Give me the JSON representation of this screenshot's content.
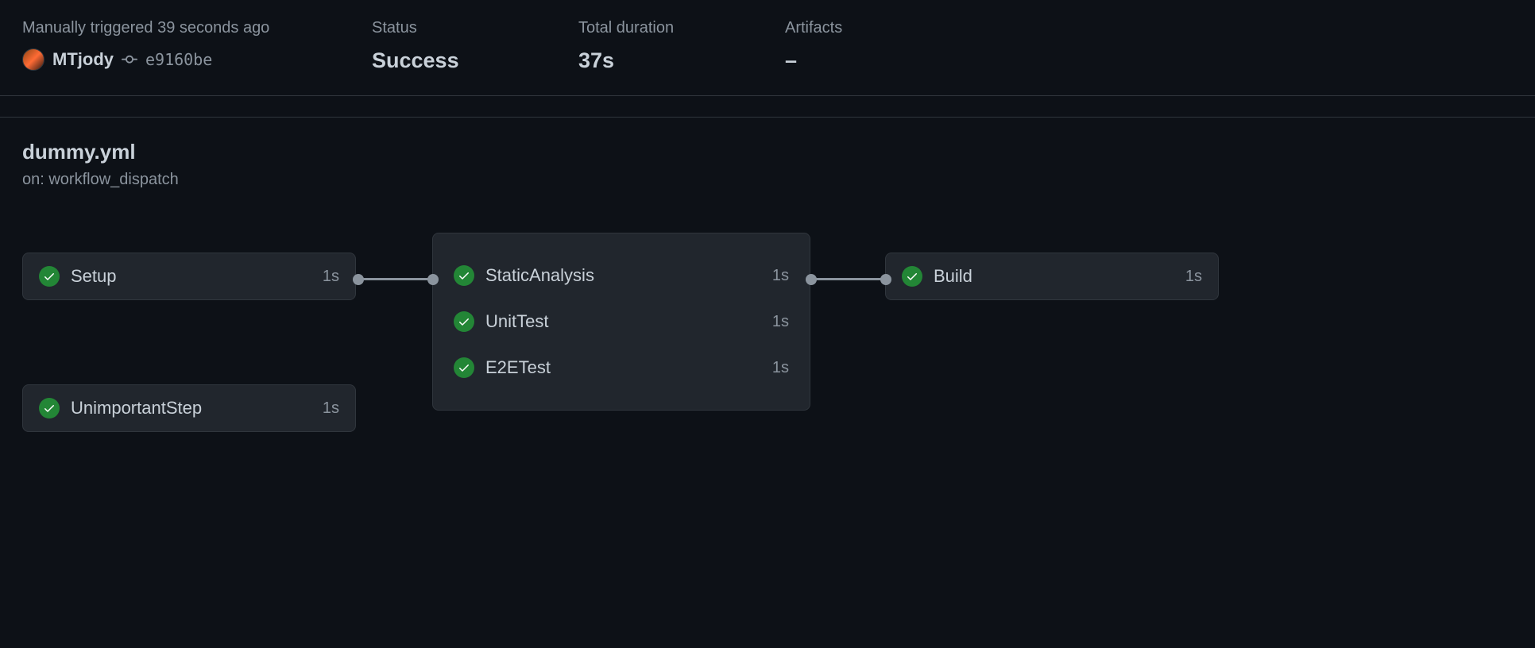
{
  "header": {
    "trigger_text": "Manually triggered 39 seconds ago",
    "author": "MTjody",
    "commit_hash": "e9160be",
    "status_label": "Status",
    "status_value": "Success",
    "duration_label": "Total duration",
    "duration_value": "37s",
    "artifacts_label": "Artifacts",
    "artifacts_value": "–"
  },
  "workflow": {
    "name": "dummy.yml",
    "trigger": "on: workflow_dispatch"
  },
  "jobs": {
    "setup": {
      "name": "Setup",
      "duration": "1s"
    },
    "unimportant": {
      "name": "UnimportantStep",
      "duration": "1s"
    },
    "static_analysis": {
      "name": "StaticAnalysis",
      "duration": "1s"
    },
    "unit_test": {
      "name": "UnitTest",
      "duration": "1s"
    },
    "e2e_test": {
      "name": "E2ETest",
      "duration": "1s"
    },
    "build": {
      "name": "Build",
      "duration": "1s"
    }
  }
}
